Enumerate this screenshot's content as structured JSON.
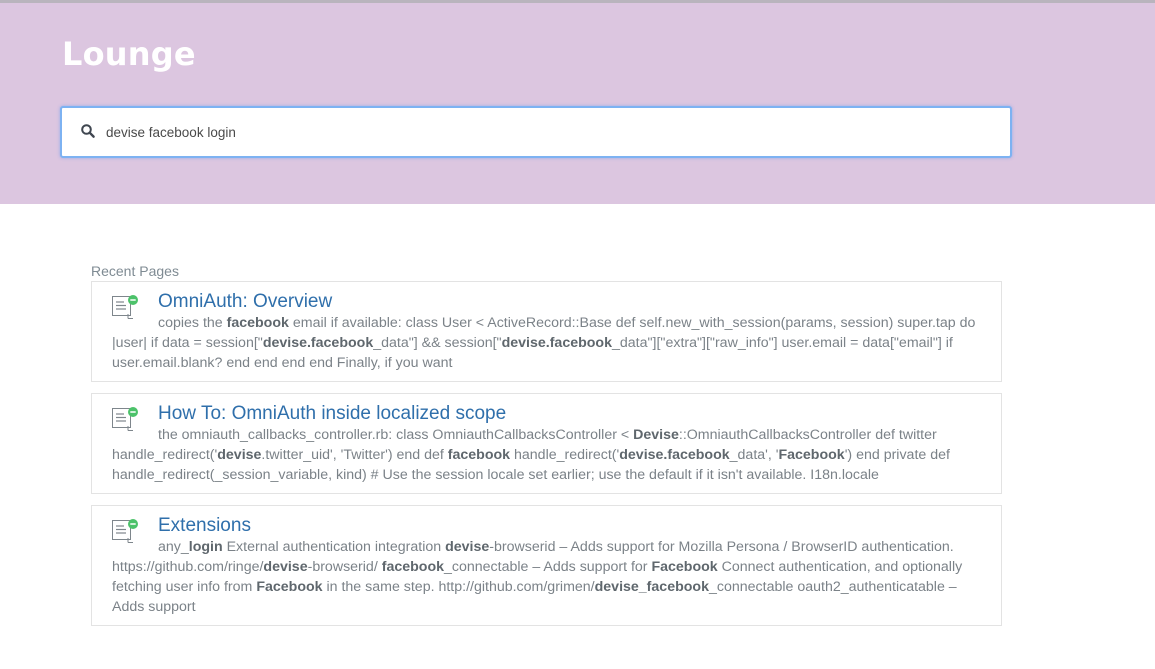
{
  "app": {
    "title": "Lounge"
  },
  "search": {
    "value": "devise facebook login"
  },
  "recent": {
    "label": "Recent Pages",
    "results": [
      {
        "title": "OmniAuth: Overview",
        "snippet": [
          "copies the ",
          {
            "b": "facebook"
          },
          " email if available: class User < ActiveRecord::Base def self.new_with_session(params, session) super.tap do |user| if data = session[\"",
          {
            "b": "devise.facebook"
          },
          "_data\"] && session[\"",
          {
            "b": "devise.facebook"
          },
          "_data\"][\"extra\"][\"raw_info\"] user.email = data[\"email\"] if user.email.blank? end end end end Finally, if you want"
        ]
      },
      {
        "title": "How To: OmniAuth inside localized scope",
        "snippet": [
          "the omniauth_callbacks_controller.rb: class OmniauthCallbacksController < ",
          {
            "b": "Devise"
          },
          "::OmniauthCallbacksController def twitter handle_redirect('",
          {
            "b": "devise"
          },
          ".twitter_uid', 'Twitter') end def ",
          {
            "b": "facebook"
          },
          " handle_redirect('",
          {
            "b": "devise.facebook"
          },
          "_data', '",
          {
            "b": "Facebook"
          },
          "') end private def handle_redirect(_session_variable, kind) # Use the session locale set earlier; use the default if it isn't available. I18n.locale"
        ]
      },
      {
        "title": "Extensions",
        "snippet": [
          "any_",
          {
            "b": "login"
          },
          " External authentication integration ",
          {
            "b": "devise"
          },
          "-browserid – Adds support for Mozilla Persona / BrowserID authentication. https://github.com/ringe/",
          {
            "b": "devise"
          },
          "-browserid/ ",
          {
            "b": "facebook"
          },
          "_connectable – Adds support for ",
          {
            "b": "Facebook"
          },
          " Connect authentication, and optionally fetching user info from ",
          {
            "b": "Facebook"
          },
          " in the same step. http://github.com/grimen/",
          {
            "b": "devise_facebook"
          },
          "_connectable oauth2_authenticatable – Adds support"
        ]
      }
    ]
  },
  "icons": {
    "search": "search-icon",
    "page": "page-icon"
  },
  "colors": {
    "hero": "#dcc6e0",
    "link": "#2f6fab",
    "focus_border": "#7db2f2",
    "page_badge": "#4cc26a"
  }
}
